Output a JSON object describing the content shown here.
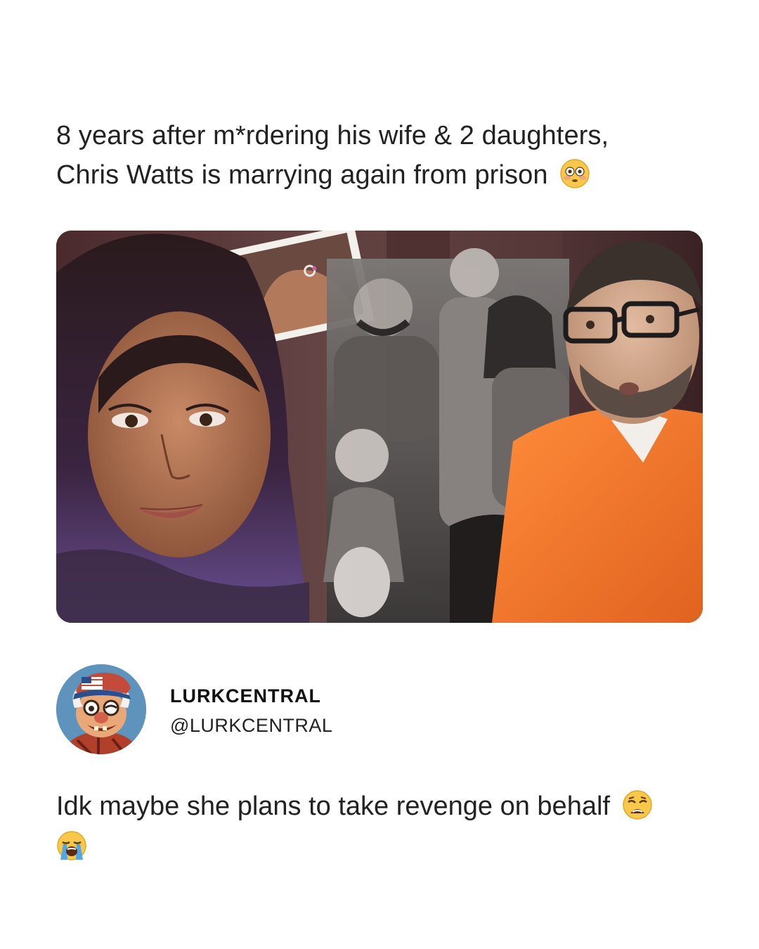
{
  "post": {
    "headline_line1": "8 years after m*rdering his wife & 2 daughters,",
    "headline_line2": "Chris Watts is marrying again from prison",
    "headline_emoji": "flushed-face-emoji"
  },
  "image": {
    "description_icon": "photo-collage"
  },
  "author": {
    "name": "LURKCENTRAL",
    "handle": "@LURKCENTRAL",
    "avatar_icon": "cartoon-old-man-avatar"
  },
  "comment": {
    "text": "Idk maybe she plans to take revenge on behalf",
    "emoji_1": "weary-face-emoji",
    "emoji_2": "loudly-crying-face-emoji"
  },
  "colors": {
    "background": "#ffffff",
    "text": "#222222",
    "prison_orange": "#f07a2e",
    "photo_bg": "#3a2426"
  }
}
